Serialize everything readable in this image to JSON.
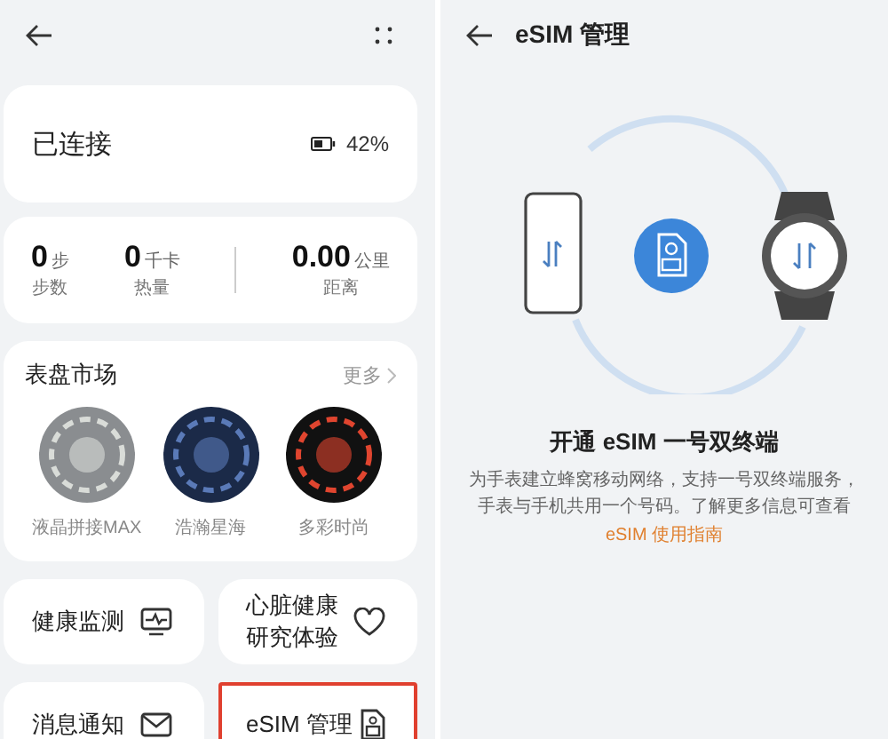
{
  "left": {
    "status": {
      "label": "已连接",
      "battery": "42%"
    },
    "stats": [
      {
        "value": "0",
        "unit": "步",
        "label": "步数"
      },
      {
        "value": "0",
        "unit": "千卡",
        "label": "热量"
      },
      {
        "value": "0.00",
        "unit": "公里",
        "label": "距离"
      }
    ],
    "watch_faces": {
      "title": "表盘市场",
      "more": "更多",
      "items": [
        {
          "name": "液晶拼接MAX",
          "kind": "lcd"
        },
        {
          "name": "浩瀚星海",
          "kind": "star"
        },
        {
          "name": "多彩时尚",
          "kind": "color"
        }
      ]
    },
    "tile_rows": [
      {
        "tiles": [
          {
            "lines": [
              "健康监测"
            ],
            "kind": "monitor",
            "highlighted": false
          },
          {
            "lines": [
              "心脏健康",
              "研究体验"
            ],
            "kind": "heart",
            "highlighted": false
          }
        ]
      },
      {
        "tiles": [
          {
            "lines": [
              "消息通知"
            ],
            "kind": "mail",
            "highlighted": false
          },
          {
            "lines": [
              "eSIM 管理"
            ],
            "kind": "sim",
            "highlighted": true
          }
        ]
      }
    ]
  },
  "right": {
    "title": "eSIM 管理",
    "heading": "开通 eSIM 一号双终端",
    "description": "为手表建立蜂窝移动网络，支持一号双终端服务，手表与手机共用一个号码。了解更多信息可查看",
    "link": "eSIM 使用指南"
  }
}
